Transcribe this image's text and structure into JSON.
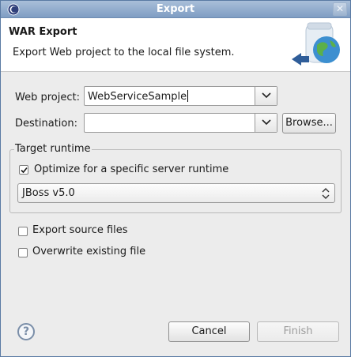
{
  "window": {
    "title": "Export",
    "close_glyph": "✕"
  },
  "header": {
    "title": "WAR Export",
    "description": "Export Web project to the local file system."
  },
  "form": {
    "web_project_label": "Web project:",
    "web_project_value": "WebServiceSample",
    "destination_label": "Destination:",
    "destination_value": "",
    "browse_label": "Browse..."
  },
  "target_runtime": {
    "group_title": "Target runtime",
    "optimize_label": "Optimize for a specific server runtime",
    "optimize_checked": true,
    "runtime_value": "JBoss v5.0"
  },
  "options": {
    "export_source_label": "Export source files",
    "export_source_checked": false,
    "overwrite_label": "Overwrite existing file",
    "overwrite_checked": false
  },
  "footer": {
    "help_glyph": "?",
    "cancel_label": "Cancel",
    "finish_label": "Finish",
    "finish_enabled": false
  },
  "icons": {
    "app": "eclipse-icon",
    "wizard": "war-export-globe-icon",
    "help": "help-icon"
  }
}
